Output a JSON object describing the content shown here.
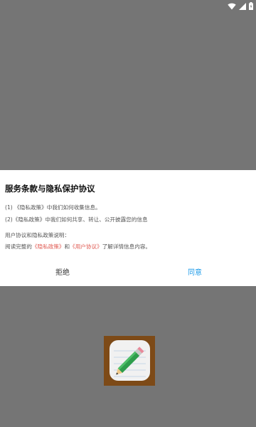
{
  "dialog": {
    "title": "服务条款与隐私保护协议",
    "line1_prefix": "(1) ",
    "line1_link": "《隐私政策》",
    "line1_suffix": "中我们如何收集信息。",
    "line2_prefix": "(2)",
    "line2_link": "《隐私政策》",
    "line2_suffix": "中我们如何共享、转让、公开披露您的信息",
    "heading": "用户协议和隐私政策说明：",
    "read_prefix": "阅读完整的",
    "privacy_link": "《隐私政策》",
    "and_text": "和",
    "user_agreement_link": "《用户协议》",
    "read_suffix": "了解详情信息内容。",
    "reject_label": "拒绝",
    "agree_label": "同意",
    "link_color": "#e05a52",
    "agree_color": "#1e9be9"
  },
  "status_bar": {
    "icons": [
      "wifi-icon",
      "signal-icon",
      "battery-icon"
    ]
  },
  "app_icon": {
    "icon": "pencil-notepad-icon",
    "background_color": "#7d4a17"
  }
}
